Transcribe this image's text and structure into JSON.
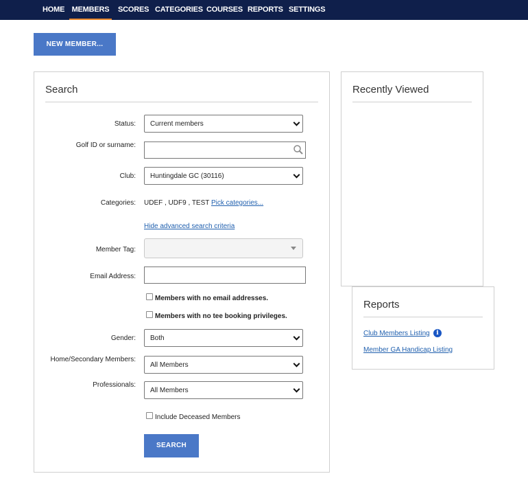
{
  "nav": {
    "items": [
      {
        "label": "HOME"
      },
      {
        "label": "MEMBERS"
      },
      {
        "label": "SCORES"
      },
      {
        "label": "CATEGORIES"
      },
      {
        "label": "COURSES"
      },
      {
        "label": "REPORTS"
      },
      {
        "label": "SETTINGS"
      }
    ],
    "active": "MEMBERS"
  },
  "new_member_button": "NEW MEMBER...",
  "search": {
    "title": "Search",
    "status_label": "Status:",
    "status_value": "Current members",
    "golfid_label": "Golf ID or surname:",
    "golfid_value": "",
    "club_label": "Club:",
    "club_value": "Huntingdale GC (30116)",
    "categories_label": "Categories:",
    "categories_value": "UDEF , UDF9 , TEST",
    "pick_categories_link": "Pick categories...",
    "hide_advanced_link": "Hide advanced search criteria",
    "member_tag_label": "Member Tag:",
    "member_tag_value": "",
    "email_label": "Email Address:",
    "email_value": "",
    "no_email_checkbox": "Members with no email addresses.",
    "no_tee_checkbox": "Members with no tee booking privileges.",
    "gender_label": "Gender:",
    "gender_value": "Both",
    "home_secondary_label": "Home/Secondary Members:",
    "home_secondary_value": "All Members",
    "professionals_label": "Professionals:",
    "professionals_value": "All Members",
    "deceased_checkbox": "Include Deceased Members",
    "search_button": "SEARCH"
  },
  "recently_viewed": {
    "title": "Recently Viewed"
  },
  "reports": {
    "title": "Reports",
    "links": [
      {
        "label": "Club Members Listing"
      },
      {
        "label": "Member GA Handicap Listing"
      }
    ]
  },
  "colors": {
    "nav_bg": "#0f1f4b",
    "accent": "#e8862b",
    "button": "#4a78c7",
    "link": "#1f5fae"
  }
}
